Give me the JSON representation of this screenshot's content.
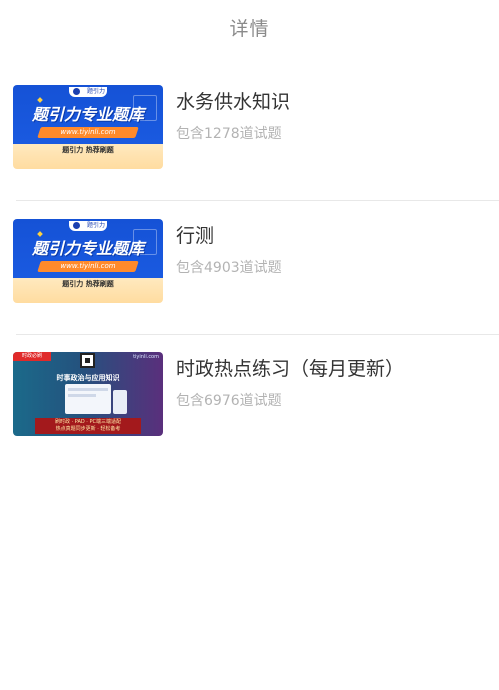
{
  "header": {
    "title": "详情"
  },
  "items": [
    {
      "name": "水务供水知识",
      "count": "包含1278道试题",
      "thumb": {
        "style": "blue",
        "headline": "题引力专业题库",
        "url": "www.tiyinli.com",
        "sub": "题引力 热荐刷题",
        "logo_text": "题引力"
      }
    },
    {
      "name": "行测",
      "count": "包含4903道试题",
      "thumb": {
        "style": "blue",
        "headline": "题引力专业题库",
        "url": "www.tiyinli.com",
        "sub": "题引力 热荐刷题",
        "logo_text": "题引力"
      }
    },
    {
      "name": "时政热点练习（每月更新）",
      "count": "包含6976道试题",
      "thumb": {
        "style": "gradient",
        "tag": "时政必刷",
        "site": "tiyinli.com",
        "headline": "时事政治与应用知识",
        "line1": "刷时政 · PAD · PC端三端适配",
        "line2": "热点真题同步更新 · 轻松备考"
      }
    }
  ],
  "colors": {
    "title": "#8a8a8a",
    "name": "#333333",
    "count": "#b3b3b3",
    "divider": "#e8e8e8",
    "banner_blue": "#1552d6"
  }
}
